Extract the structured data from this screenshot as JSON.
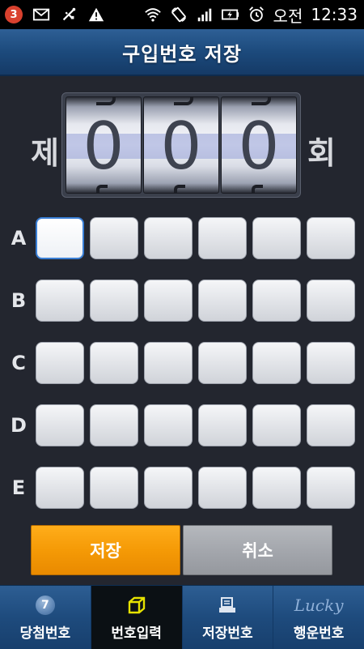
{
  "status_bar": {
    "notification_count": "3",
    "icons": [
      "mail-icon",
      "usb-icon",
      "warning-icon",
      "wifi-icon",
      "rotate-icon",
      "signal-icon",
      "battery-icon",
      "alarm-icon"
    ],
    "ampm": "오전",
    "time": "12:33"
  },
  "title_bar": {
    "title": "구입번호 저장"
  },
  "round": {
    "prefix": "제",
    "digits": [
      "0",
      "0",
      "0"
    ],
    "suffix": "회"
  },
  "grid": {
    "rows": [
      {
        "label": "A"
      },
      {
        "label": "B"
      },
      {
        "label": "C"
      },
      {
        "label": "D"
      },
      {
        "label": "E"
      }
    ],
    "cells_per_row": 6,
    "active_cell": "A1"
  },
  "actions": {
    "save_label": "저장",
    "cancel_label": "취소"
  },
  "tabs": [
    {
      "label": "당첨번호",
      "icon": "lotto-ball-icon",
      "icon_text": "7",
      "selected": false
    },
    {
      "label": "번호입력",
      "icon": "input-box-icon",
      "selected": true
    },
    {
      "label": "저장번호",
      "icon": "saved-list-icon",
      "selected": false
    },
    {
      "label": "행운번호",
      "icon": "lucky-icon",
      "icon_text": "Lucky",
      "selected": false
    }
  ],
  "colors": {
    "accent_orange": "#f59a06",
    "active_cell_border": "#3a7fd6",
    "title_bar_blue": "#1c4a7c",
    "background": "#23262f"
  }
}
